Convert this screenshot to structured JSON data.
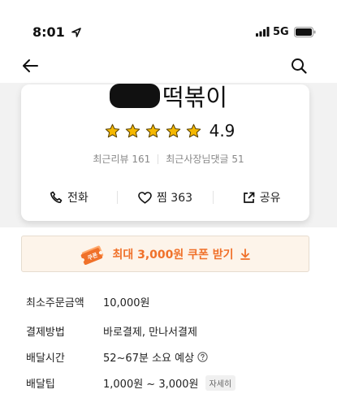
{
  "status_bar": {
    "time": "8:01",
    "network": "5G"
  },
  "store": {
    "name": "떡볶이",
    "rating": "4.9",
    "recent_reviews": "최근리뷰 161",
    "owner_replies": "최근사장님댓글 51"
  },
  "actions": {
    "call": "전화",
    "like": "찜 363",
    "share": "공유"
  },
  "coupon": {
    "badge": "쿠폰",
    "label": "최대 3,000원 쿠폰 받기"
  },
  "info": [
    {
      "label": "최소주문금액",
      "value": "10,000원"
    },
    {
      "label": "결제방법",
      "value": "바로결제, 만나서결제"
    },
    {
      "label": "배달시간",
      "value": "52~67분 소요 예상"
    },
    {
      "label": "배달팁",
      "value": "1,000원 ~ 3,000원",
      "detail": "자세히"
    }
  ],
  "colors": {
    "accent": "#f0712a",
    "star": "#f5b800",
    "coupon_bg": "#fdf4ea"
  },
  "icons": [
    "location-arrow-icon",
    "signal-icon",
    "battery-icon",
    "back-arrow-icon",
    "search-icon",
    "star-icon",
    "phone-icon",
    "heart-icon",
    "share-icon",
    "coupon-ticket-icon",
    "download-arrow-icon",
    "help-circle-icon"
  ]
}
